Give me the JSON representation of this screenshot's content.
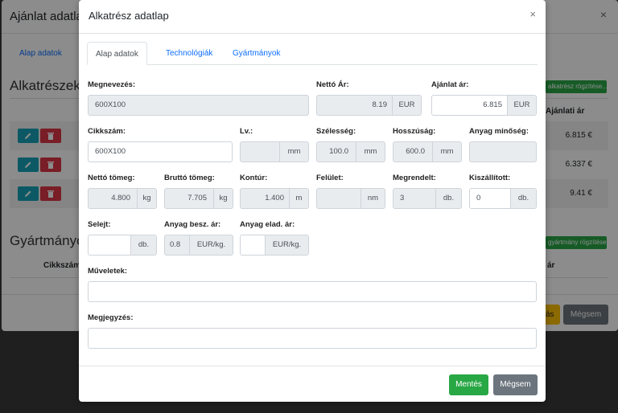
{
  "background": {
    "title": "Ajánlat adatlap",
    "close": "×",
    "tab": "Alap adatok",
    "section_parts": "Alkatrészek",
    "add_part_button": "alkatrész rögzítése...",
    "col_offer_price": "Ajánlati ár",
    "rows": [
      {
        "price": "6.815 €"
      },
      {
        "price": "6.337 €"
      },
      {
        "price": "9.41 €"
      }
    ],
    "section_products": "Gyártmányok",
    "add_product_button": "gyártmány rögzítése...",
    "col_code": "Cikkszám",
    "col_price": "ár",
    "save_fragment": "ás",
    "cancel": "Mégsem"
  },
  "modal": {
    "title": "Alkatrész adatlap",
    "close": "×",
    "tabs": [
      "Alap adatok",
      "Technológiák",
      "Gyártmányok"
    ],
    "fields": {
      "name": {
        "label": "Megnevezés:",
        "value": "600X100"
      },
      "net_price": {
        "label": "Nettó Ár:",
        "value": "8.19",
        "unit": "EUR"
      },
      "offer_price": {
        "label": "Ajánlat ár:",
        "value": "6.815",
        "unit": "EUR"
      },
      "code": {
        "label": "Cikkszám:",
        "value": "600X100"
      },
      "lv": {
        "label": "Lv.:",
        "value": "",
        "unit": "mm"
      },
      "width": {
        "label": "Szélesség:",
        "value": "100.0",
        "unit": "mm"
      },
      "length": {
        "label": "Hosszúság:",
        "value": "600.0",
        "unit": "mm"
      },
      "material": {
        "label": "Anyag minőség:",
        "value": ""
      },
      "net_weight": {
        "label": "Nettó tömeg:",
        "value": "4.800",
        "unit": "kg"
      },
      "gross_weight": {
        "label": "Bruttó tömeg:",
        "value": "7.705",
        "unit": "kg"
      },
      "contour": {
        "label": "Kontúr:",
        "value": "1.400",
        "unit": "m"
      },
      "surface": {
        "label": "Felület:",
        "value": "",
        "unit": "nm"
      },
      "ordered": {
        "label": "Megrendelt:",
        "value": "3",
        "unit": "db."
      },
      "delivered": {
        "label": "Kiszállított:",
        "value": "0",
        "unit": "db."
      },
      "scrap": {
        "label": "Selejt:",
        "value": "",
        "unit": "db."
      },
      "mat_buy": {
        "label": "Anyag besz. ár:",
        "value": "0.8",
        "unit": "EUR/kg."
      },
      "mat_sell": {
        "label": "Anyag elad. ár:",
        "value": "",
        "unit": "EUR/kg."
      },
      "operations": {
        "label": "Műveletek:",
        "value": ""
      },
      "notes": {
        "label": "Megjegyzés:",
        "value": ""
      }
    },
    "save_button": "Mentés",
    "cancel_button": "Mégsem"
  }
}
